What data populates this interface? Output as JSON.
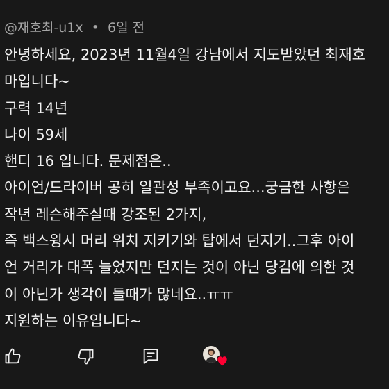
{
  "comment": {
    "author": "@재호최-u1x",
    "separator": "•",
    "time": "6일 전",
    "lines": [
      "안녕하세요, 2023년 11월4일 강남에서 지도받았던 최재호",
      "마입니다~",
      "구력 14년",
      "나이 59세",
      "핸디 16 입니다. 문제점은..",
      "아이언/드라이버 공히 일관성 부족이고요...궁금한 사항은",
      "작년 레슨해주실때 강조된 2가지,",
      "즉 백스윙시 머리 위치 지키기와 탑에서 던지기..그후 아이",
      "언 거리가 대폭 늘었지만 던지는 것이 아닌 당김에 의한 것",
      "이 아닌가 생각이 들때가 많네요..ㅠㅠ",
      "지원하는 이유입니다~"
    ]
  },
  "actions": {
    "like_icon": "thumbs-up-icon",
    "dislike_icon": "thumbs-down-icon",
    "reply_icon": "comment-icon",
    "creator_heart_icon": "heart-icon",
    "heart_color": "#ff0033"
  }
}
